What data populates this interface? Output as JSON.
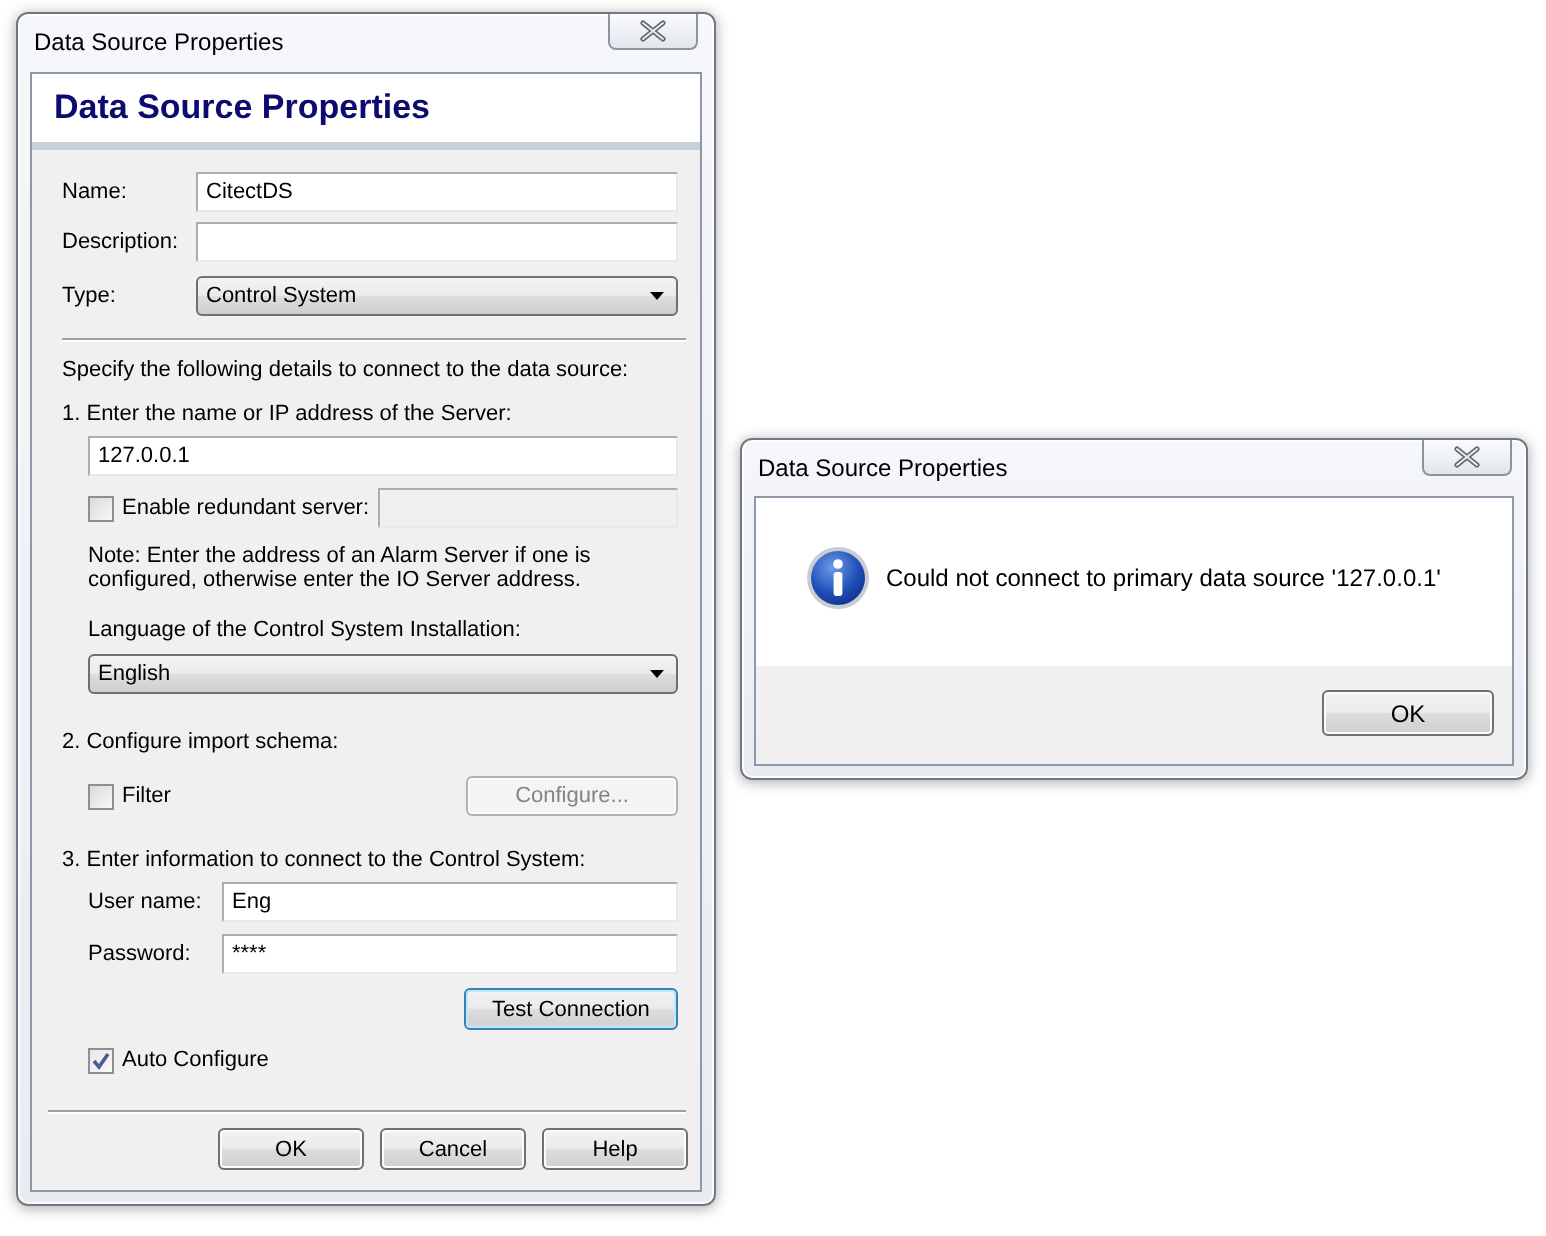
{
  "main_dialog": {
    "title": "Data Source Properties",
    "heading": "Data Source Properties",
    "fields": [
      {
        "label": "Name:",
        "kind": "text",
        "value": "CitectDS"
      },
      {
        "label": "Description:",
        "kind": "text"
      },
      {
        "label": "Type:",
        "kind": "dropdown",
        "value": "Control System"
      }
    ],
    "instructions": "Specify the following details to connect to the data source:",
    "server": {
      "step": "1. Enter the name or IP address of the Server:",
      "value": "127.0.0.1",
      "redundant": {
        "label": "Enable redundant server:",
        "checked": false,
        "disabled": true
      },
      "note": "Note: Enter the address of an Alarm Server if one is configured, otherwise enter the IO Server address.",
      "language_label": "Language of the Control System Installation:",
      "language": "English"
    },
    "schema": {
      "step": "2. Configure import schema:",
      "filter": {
        "label": "Filter",
        "checked": false
      },
      "configure_button": {
        "label": "Configure...",
        "disabled": true
      }
    },
    "credentials": {
      "step": "3. Enter information to connect to the Control System:",
      "fields": [
        {
          "label": "User name:",
          "value": "Eng"
        },
        {
          "label": "Password:",
          "value": "****"
        }
      ],
      "test_button": {
        "label": "Test Connection",
        "focused": true
      },
      "auto_configure": {
        "label": "Auto Configure",
        "checked": true
      }
    },
    "buttons": [
      "OK",
      "Cancel",
      "Help"
    ]
  },
  "message_box": {
    "title": "Data Source Properties",
    "message": "Could not connect to primary data source '127.0.0.1'",
    "buttons": [
      "OK"
    ]
  }
}
